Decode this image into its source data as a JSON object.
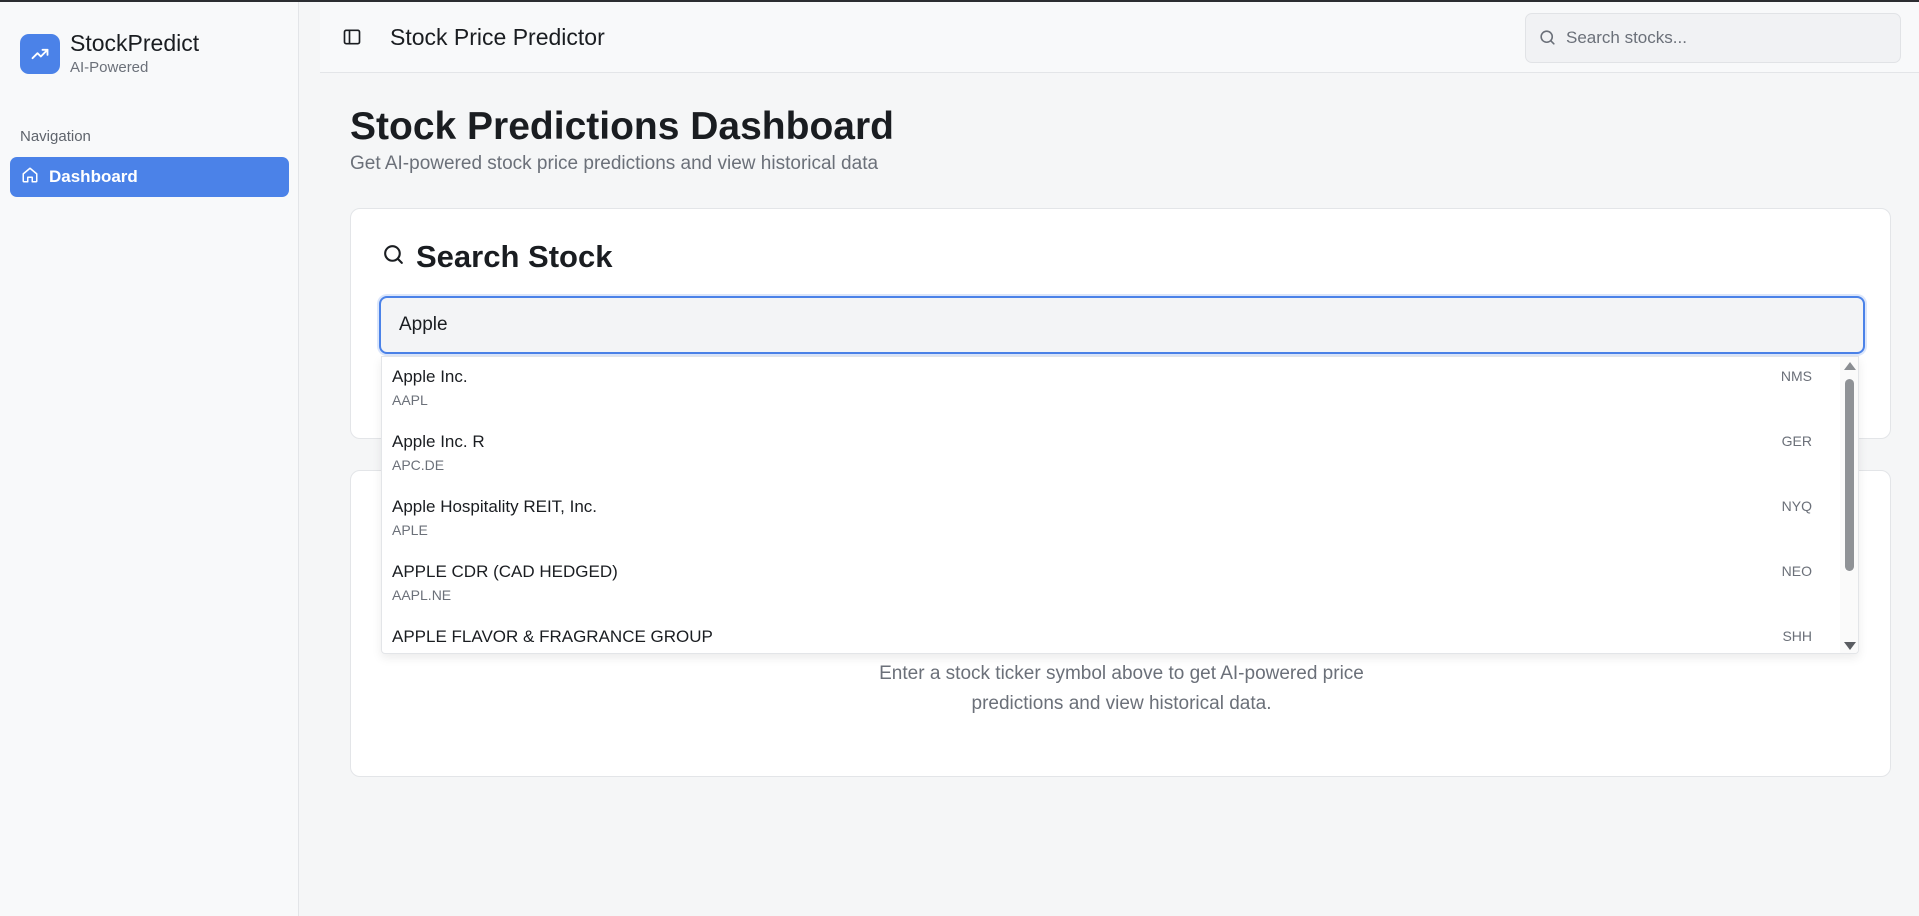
{
  "sidebar": {
    "brand_name": "StockPredict",
    "brand_sub": "AI-Powered",
    "nav_heading": "Navigation",
    "items": [
      {
        "label": "Dashboard",
        "icon": "home-icon",
        "active": true
      }
    ]
  },
  "header": {
    "title": "Stock Price Predictor",
    "search_placeholder": "Search stocks..."
  },
  "main": {
    "title": "Stock Predictions Dashboard",
    "subtitle": "Get AI-powered stock price predictions and view historical data",
    "search_card": {
      "heading": "Search Stock",
      "input_value": "Apple"
    },
    "empty_message_line1": "Enter a stock ticker symbol above to get AI-powered price",
    "empty_message_line2": "predictions and view historical data."
  },
  "dropdown": {
    "results": [
      {
        "name": "Apple Inc.",
        "symbol": "AAPL",
        "exchange": "NMS"
      },
      {
        "name": "Apple Inc. R",
        "symbol": "APC.DE",
        "exchange": "GER"
      },
      {
        "name": "Apple Hospitality REIT, Inc.",
        "symbol": "APLE",
        "exchange": "NYQ"
      },
      {
        "name": "APPLE CDR (CAD HEDGED)",
        "symbol": "AAPL.NE",
        "exchange": "NEO"
      },
      {
        "name": "APPLE FLAVOR & FRAGRANCE GROUP",
        "symbol": "",
        "exchange": "SHH"
      }
    ]
  },
  "colors": {
    "accent": "#4b82e8",
    "background": "#f5f6f7",
    "text_muted": "#6b7079"
  }
}
